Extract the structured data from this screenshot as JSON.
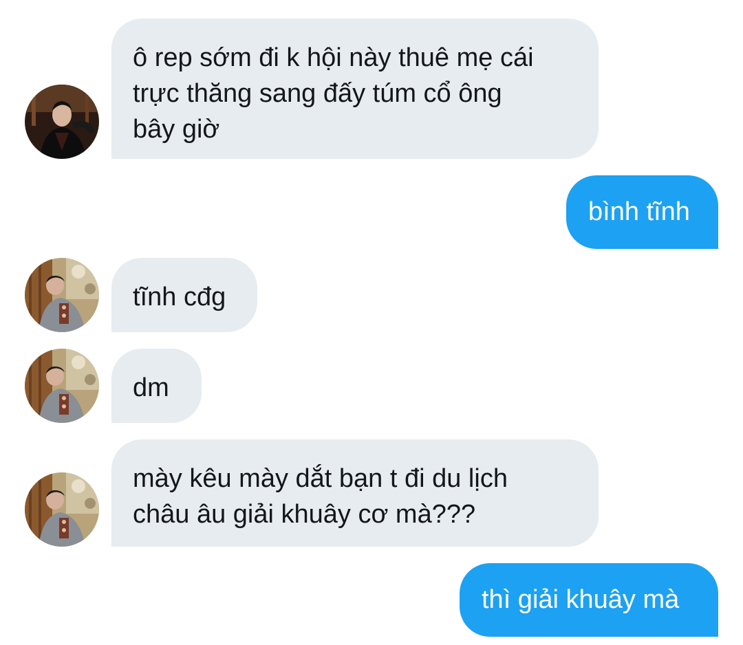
{
  "conversation": {
    "messages": [
      {
        "direction": "incoming",
        "text": "ô rep sớm đi k hội này thuê mẹ cái\ntrực thăng sang đấy túm cổ ông\nbây giờ",
        "avatar_icon": "avatar-dark-jacket-icon"
      },
      {
        "direction": "outgoing",
        "text": "bình tĩnh"
      },
      {
        "direction": "incoming",
        "text": "tĩnh cđg",
        "avatar_icon": "avatar-outdoor-selfie-icon"
      },
      {
        "direction": "incoming",
        "text": "dm",
        "avatar_icon": "avatar-outdoor-selfie-icon"
      },
      {
        "direction": "incoming",
        "text": "mày kêu mày dắt bạn t đi du lịch\nchâu âu giải khuây cơ mà???",
        "avatar_icon": "avatar-outdoor-selfie-icon"
      },
      {
        "direction": "outgoing",
        "text": "thì giải khuây mà"
      }
    ]
  },
  "colors": {
    "incoming_bubble": "#e6ecf0",
    "outgoing_bubble": "#1da1f2",
    "incoming_text": "#14171a",
    "outgoing_text": "#ffffff",
    "background": "#ffffff"
  }
}
